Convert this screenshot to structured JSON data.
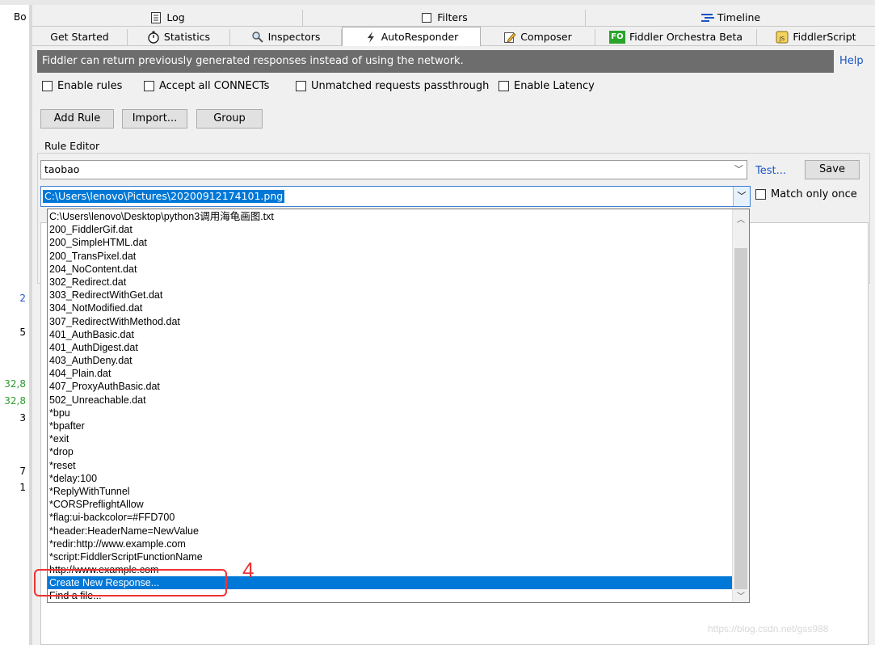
{
  "left_strip": {
    "header": "Bo",
    "numbers": [
      {
        "text": "2",
        "color": "#1a55c8"
      },
      {
        "text": "5",
        "color": "#000000"
      },
      {
        "text": "32,8",
        "color": "#2e9a2e"
      },
      {
        "text": "32,8",
        "color": "#2e9a2e"
      },
      {
        "text": "3",
        "color": "#000000"
      },
      {
        "text": "7",
        "color": "#000000"
      },
      {
        "text": "1",
        "color": "#000000"
      }
    ]
  },
  "tabs_row1": [
    {
      "label": "Log",
      "icon": "log-icon"
    },
    {
      "label": "Filters",
      "icon": "checkbox-icon"
    },
    {
      "label": "Timeline",
      "icon": "timeline-icon"
    }
  ],
  "tabs_row2": [
    {
      "label": "Get Started"
    },
    {
      "label": "Statistics",
      "icon": "stopwatch-icon"
    },
    {
      "label": "Inspectors",
      "icon": "magnifier-icon"
    },
    {
      "label": "AutoResponder",
      "icon": "lightning-icon"
    },
    {
      "label": "Composer",
      "icon": "pencil-icon"
    },
    {
      "label": "Fiddler Orchestra Beta",
      "icon": "fo-icon",
      "icon_text": "FO"
    },
    {
      "label": "FiddlerScript",
      "icon": "js-icon"
    }
  ],
  "info_bar": "Fiddler can return previously generated responses instead of using the network.",
  "help": "Help",
  "options": {
    "enable_rules": "Enable rules",
    "accept_connects": "Accept all CONNECTs",
    "unmatched": "Unmatched requests passthrough",
    "latency": "Enable Latency"
  },
  "buttons": {
    "add_rule": "Add Rule",
    "import": "Import...",
    "group": "Group"
  },
  "rule_editor": {
    "label": "Rule Editor",
    "match_value": "taobao",
    "test": "Test...",
    "save": "Save",
    "response_value": "C:\\Users\\lenovo\\Pictures\\20200912174101.png",
    "match_once": "Match only once"
  },
  "dropdown_items": [
    "C:\\Users\\lenovo\\Desktop\\python3调用海龟画图.txt",
    "200_FiddlerGif.dat",
    "200_SimpleHTML.dat",
    "200_TransPixel.dat",
    "204_NoContent.dat",
    "302_Redirect.dat",
    "303_RedirectWithGet.dat",
    "304_NotModified.dat",
    "307_RedirectWithMethod.dat",
    "401_AuthBasic.dat",
    "401_AuthDigest.dat",
    "403_AuthDeny.dat",
    "404_Plain.dat",
    "407_ProxyAuthBasic.dat",
    "502_Unreachable.dat",
    "*bpu",
    "*bpafter",
    "*exit",
    "*drop",
    "*reset",
    "*delay:100",
    "*ReplyWithTunnel",
    "*CORSPreflightAllow",
    "*flag:ui-backcolor=#FFD700",
    "*header:HeaderName=NewValue",
    "*redir:http://www.example.com",
    "*script:FiddlerScriptFunctionName",
    "http://www.example.com",
    "Create New Response...",
    "Find a file..."
  ],
  "selected_index": 28,
  "annotation": "4",
  "watermark": "https://blog.csdn.net/gss988",
  "colors": {
    "accent": "#0078d7",
    "link": "#1a55c8",
    "annotation": "#ee3333",
    "info_bar": "#6d6d6d"
  }
}
